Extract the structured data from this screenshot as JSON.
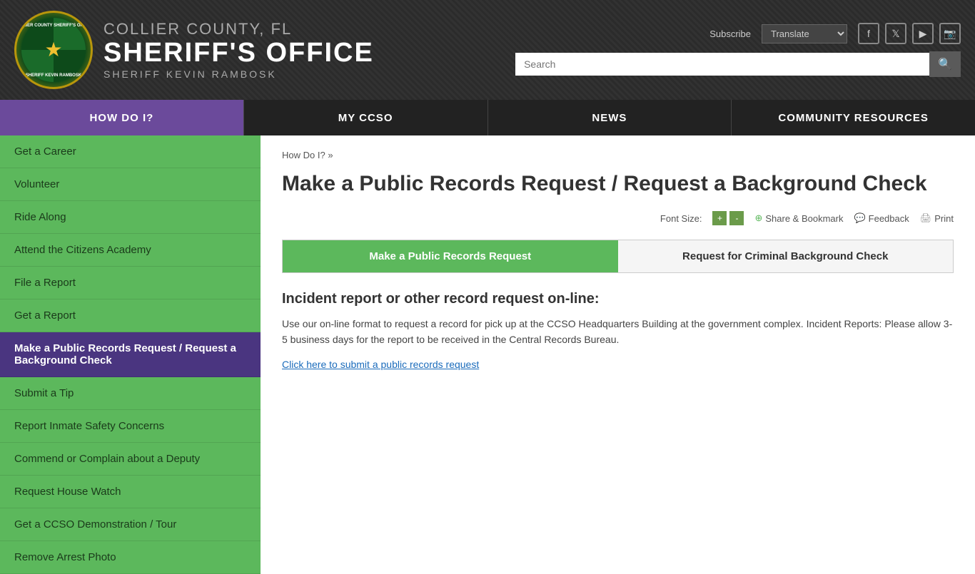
{
  "header": {
    "county": "COLLIER COUNTY, FL",
    "office": "SHERIFF'S OFFICE",
    "sheriff": "SHERIFF KEVIN RAMBOSK",
    "subscribe_label": "Subscribe",
    "translate_label": "Translate",
    "search_placeholder": "Search"
  },
  "nav": {
    "items": [
      {
        "label": "HOW DO I?",
        "active": true
      },
      {
        "label": "MY CCSO",
        "active": false
      },
      {
        "label": "NEWS",
        "active": false
      },
      {
        "label": "COMMUNITY RESOURCES",
        "active": false
      }
    ]
  },
  "sidebar": {
    "items": [
      {
        "label": "Get a Career",
        "active": false
      },
      {
        "label": "Volunteer",
        "active": false
      },
      {
        "label": "Ride Along",
        "active": false
      },
      {
        "label": "Attend the Citizens Academy",
        "active": false
      },
      {
        "label": "File a Report",
        "active": false
      },
      {
        "label": "Get a Report",
        "active": false
      },
      {
        "label": "Make a Public Records Request / Request a Background Check",
        "active": true
      },
      {
        "label": "Submit a Tip",
        "active": false
      },
      {
        "label": "Report Inmate Safety Concerns",
        "active": false
      },
      {
        "label": "Commend or Complain about a Deputy",
        "active": false
      },
      {
        "label": "Request House Watch",
        "active": false
      },
      {
        "label": "Get a CCSO Demonstration / Tour",
        "active": false
      },
      {
        "label": "Remove Arrest Photo",
        "active": false
      }
    ]
  },
  "breadcrumb": {
    "text": "How Do I?",
    "separator": "»"
  },
  "page": {
    "title": "Make a Public Records Request / Request a Background Check",
    "font_size_label": "Font Size:",
    "share_label": "Share & Bookmark",
    "feedback_label": "Feedback",
    "print_label": "Print"
  },
  "tabs": [
    {
      "label": "Make a Public Records Request",
      "active": true
    },
    {
      "label": "Request for Criminal Background Check",
      "active": false
    }
  ],
  "content": {
    "section_title": "Incident report or other record request on-line:",
    "section_body": "Use our on-line format to request a record for pick up at the CCSO Headquarters Building at the government complex. Incident Reports: Please allow 3-5 business days for the report to be received in the Central Records Bureau.",
    "link_text": "Click here to submit a public records request"
  }
}
